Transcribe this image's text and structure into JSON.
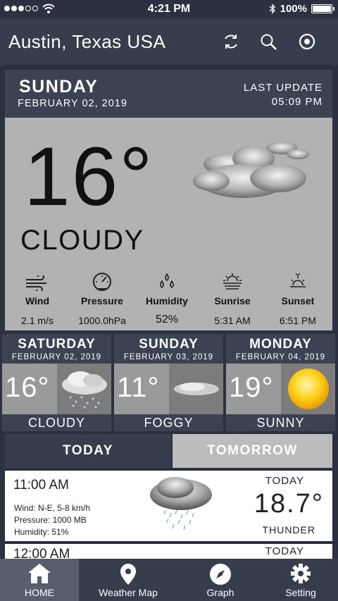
{
  "status_bar": {
    "time": "4:21 PM",
    "battery": "100%"
  },
  "header": {
    "city": "Austin, Texas USA",
    "icons": [
      "refresh-icon",
      "search-icon",
      "target-icon"
    ]
  },
  "current": {
    "day": "SUNDAY",
    "date": "FEBRUARY 02, 2019",
    "last_update_label": "LAST UPDATE",
    "last_update_time": "05:09 PM",
    "temperature": "16°",
    "condition": "CLOUDY",
    "stats": [
      {
        "label": "Wind",
        "value": "2.1 m/s",
        "icon": "wind-icon"
      },
      {
        "label": "Pressure",
        "value": "1000.0hPa",
        "icon": "gauge-icon"
      },
      {
        "label": "Humidity",
        "value": "52%",
        "icon": "droplets-icon"
      },
      {
        "label": "Sunrise",
        "value": "5:31 AM",
        "icon": "sunrise-icon"
      },
      {
        "label": "Sunset",
        "value": "6:51 PM",
        "icon": "sunset-icon"
      }
    ]
  },
  "forecast": [
    {
      "day": "SATURDAY",
      "date": "FEBRUARY 02, 2019",
      "temp": "16°",
      "condition": "CLOUDY"
    },
    {
      "day": "SUNDAY",
      "date": "FEBRUARY 03, 2019",
      "temp": "11°",
      "condition": "FOGGY"
    },
    {
      "day": "MONDAY",
      "date": "FEBRUARY 04, 2019",
      "temp": "19°",
      "condition": "SUNNY"
    }
  ],
  "tabs": {
    "today": "TODAY",
    "tomorrow": "TOMORROW"
  },
  "hourly": [
    {
      "time": "11:00 AM",
      "wind": "Wind: N-E, 5-8 km/h",
      "pressure": "Pressure: 1000 MB",
      "humidity": "Humidity: 51%",
      "label": "TODAY",
      "temp": "18.7°",
      "condition": "THUNDER"
    },
    {
      "time": "12:00 AM",
      "label": "TODAY"
    }
  ],
  "nav": [
    {
      "label": "HOME",
      "icon": "home-icon"
    },
    {
      "label": "Weather Map",
      "icon": "map-pin-icon"
    },
    {
      "label": "Graph",
      "icon": "compass-icon"
    },
    {
      "label": "Setting",
      "icon": "gear-icon"
    }
  ]
}
